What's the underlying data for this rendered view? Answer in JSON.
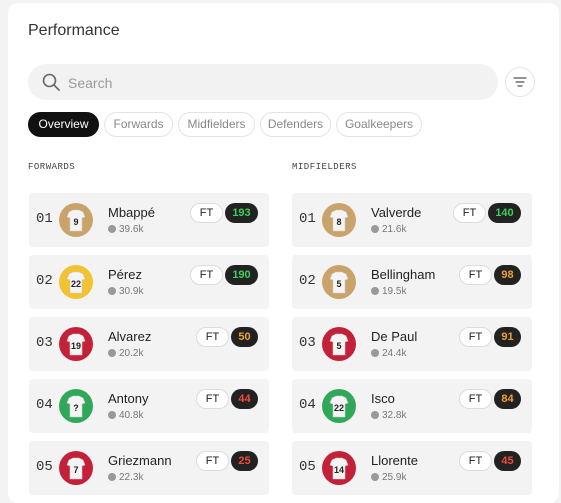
{
  "header": {
    "title": "Performance"
  },
  "search": {
    "placeholder": "Search"
  },
  "tabs": [
    {
      "label": "Overview",
      "active": true
    },
    {
      "label": "Forwards",
      "active": false
    },
    {
      "label": "Midfielders",
      "active": false
    },
    {
      "label": "Defenders",
      "active": false
    },
    {
      "label": "Goalkeepers",
      "active": false
    }
  ],
  "forwards": {
    "heading": "FORWARDS",
    "players": [
      {
        "rank": "01",
        "name": "Mbappé",
        "followers": "39.6k",
        "status": "FT",
        "score": "193",
        "score_color": "#3ccf5b",
        "jersey_color": "#c9a36a",
        "number": "9"
      },
      {
        "rank": "02",
        "name": "Pérez",
        "followers": "30.9k",
        "status": "FT",
        "score": "190",
        "score_color": "#3ccf5b",
        "jersey_color": "#f2c230",
        "number": "22"
      },
      {
        "rank": "03",
        "name": "Alvarez",
        "followers": "20.2k",
        "status": "FT",
        "score": "50",
        "score_color": "#f0a030",
        "jersey_color": "#c3203a",
        "number": "19"
      },
      {
        "rank": "04",
        "name": "Antony",
        "followers": "40.8k",
        "status": "FT",
        "score": "44",
        "score_color": "#ef4d3d",
        "jersey_color": "#2fa85a",
        "number": "?"
      },
      {
        "rank": "05",
        "name": "Griezmann",
        "followers": "22.3k",
        "status": "FT",
        "score": "25",
        "score_color": "#ef4d3d",
        "jersey_color": "#c3203a",
        "number": "7"
      }
    ]
  },
  "midfielders": {
    "heading": "MIDFIELDERS",
    "players": [
      {
        "rank": "01",
        "name": "Valverde",
        "followers": "21.6k",
        "status": "FT",
        "score": "140",
        "score_color": "#3ccf5b",
        "jersey_color": "#c9a36a",
        "number": "8"
      },
      {
        "rank": "02",
        "name": "Bellingham",
        "followers": "19.5k",
        "status": "FT",
        "score": "98",
        "score_color": "#f0a030",
        "jersey_color": "#c9a36a",
        "number": "5"
      },
      {
        "rank": "03",
        "name": "De Paul",
        "followers": "24.4k",
        "status": "FT",
        "score": "91",
        "score_color": "#f0a030",
        "jersey_color": "#c3203a",
        "number": "5"
      },
      {
        "rank": "04",
        "name": "Isco",
        "followers": "32.8k",
        "status": "FT",
        "score": "84",
        "score_color": "#f0a030",
        "jersey_color": "#2fa85a",
        "number": "22"
      },
      {
        "rank": "05",
        "name": "Llorente",
        "followers": "25.9k",
        "status": "FT",
        "score": "45",
        "score_color": "#ef4d3d",
        "jersey_color": "#c3203a",
        "number": "14"
      }
    ]
  }
}
